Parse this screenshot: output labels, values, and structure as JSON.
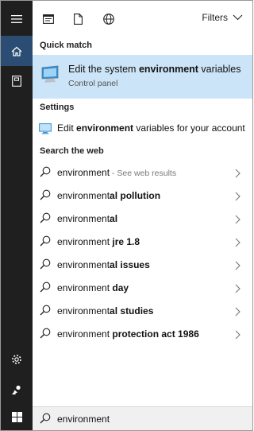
{
  "topbar": {
    "filters_label": "Filters",
    "icons": [
      "document-list-icon",
      "document-icon",
      "globe-icon"
    ]
  },
  "sections": {
    "quick_match": "Quick match",
    "settings": "Settings",
    "search_web": "Search the web"
  },
  "quick_match": {
    "title_pre": "Edit the system ",
    "title_bold": "environment",
    "title_post": " variables",
    "subtitle": "Control panel",
    "icon": "monitor-icon"
  },
  "settings_item": {
    "pre": "Edit ",
    "bold": "environment",
    "post": " variables for your account",
    "icon": "monitor-settings-icon"
  },
  "web_results": [
    {
      "plain": "environment",
      "bold": "",
      "hint": " - See web results"
    },
    {
      "plain": "environment",
      "bold": "al pollution",
      "hint": ""
    },
    {
      "plain": "environment",
      "bold": "al",
      "hint": ""
    },
    {
      "plain": "environment ",
      "bold": "jre 1.8",
      "hint": ""
    },
    {
      "plain": "environment",
      "bold": "al issues",
      "hint": ""
    },
    {
      "plain": "environment ",
      "bold": "day",
      "hint": ""
    },
    {
      "plain": "environment",
      "bold": "al studies",
      "hint": ""
    },
    {
      "plain": "environment ",
      "bold": "protection act 1986",
      "hint": ""
    }
  ],
  "search": {
    "value": "environment",
    "icon": "search-icon"
  },
  "rail": {
    "items": [
      "hamburger-menu-icon",
      "home-icon",
      "notebook-icon",
      "settings-icon",
      "feedback-icon",
      "windows-start-icon"
    ]
  },
  "colors": {
    "rail_bg": "#1f1f1f",
    "rail_active": "#2b4d73",
    "quick_match_bg": "#cce4f7",
    "search_bg": "#f0f0f0"
  }
}
